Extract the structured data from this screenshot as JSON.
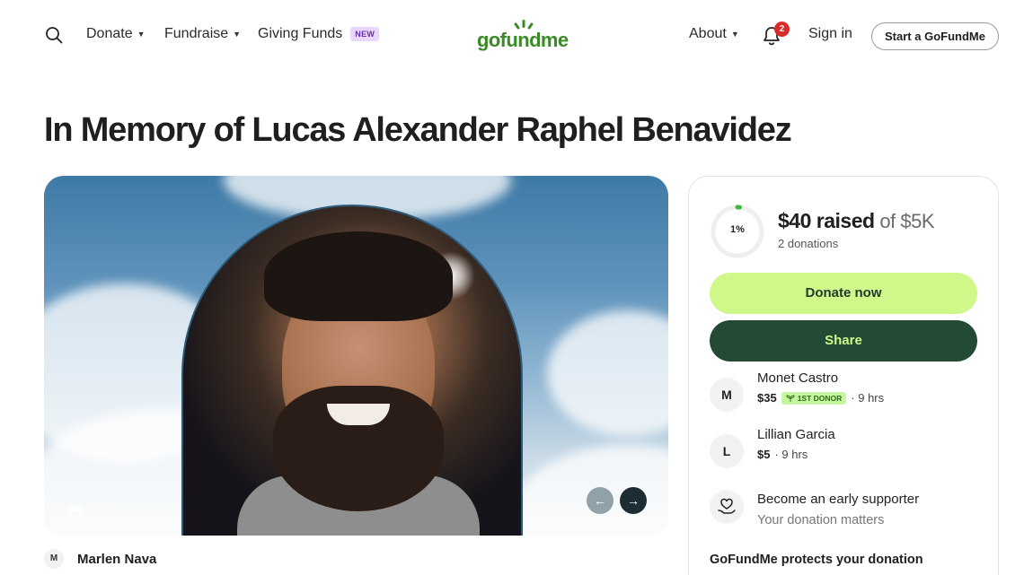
{
  "header": {
    "nav": {
      "donate": "Donate",
      "fundraise": "Fundraise",
      "giving_funds": "Giving Funds",
      "giving_funds_badge": "NEW",
      "about": "About"
    },
    "logo_text": "gofundme",
    "notifications_count": "2",
    "sign_in": "Sign in",
    "start_button": "Start a GoFundMe"
  },
  "campaign": {
    "title": "In Memory of Lucas Alexander Raphel Benavidez",
    "organizer_initial": "M",
    "organizer_name": "Marlen Nava",
    "media": {
      "prev_icon": "arrow-left-icon",
      "next_icon": "arrow-right-icon"
    }
  },
  "donation_card": {
    "progress_percent": 1,
    "progress_label": "1%",
    "raised": "$40 raised",
    "goal": "of $5K",
    "donations_count": "2 donations",
    "donate_button": "Donate now",
    "share_button": "Share",
    "donors": [
      {
        "initial": "M",
        "name": "Monet Castro",
        "amount": "$35",
        "badge": "1ST DONOR",
        "time": "· 9 hrs"
      },
      {
        "initial": "L",
        "name": "Lillian Garcia",
        "amount": "$5",
        "time": "· 9 hrs"
      }
    ],
    "early_supporter": {
      "title": "Become an early supporter",
      "subtitle": "Your donation matters"
    },
    "protect_heading": "GoFundMe protects your donation"
  },
  "colors": {
    "brand_green": "#3a8a26",
    "donate_button_bg": "#d0f78a",
    "share_button_bg": "#224a34",
    "notification_red": "#d92b2b",
    "new_badge_bg": "#e9d8fb"
  }
}
